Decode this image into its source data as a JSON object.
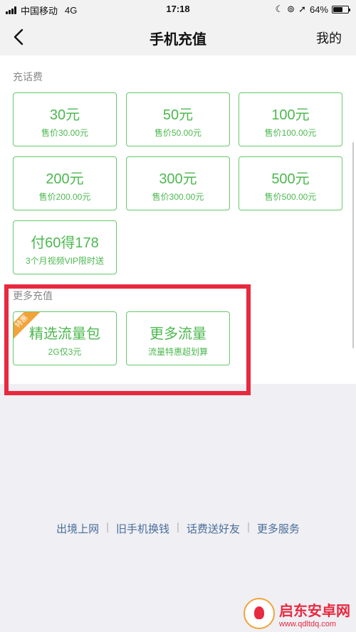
{
  "status_bar": {
    "carrier": "中国移动",
    "network": "4G",
    "time": "17:18",
    "battery": "64%",
    "battery_level": 0.64
  },
  "nav": {
    "title": "手机充值",
    "right_label": "我的"
  },
  "topup": {
    "section_label": "充话费",
    "cards": [
      {
        "amount": "30元",
        "price": "售价30.00元"
      },
      {
        "amount": "50元",
        "price": "售价50.00元"
      },
      {
        "amount": "100元",
        "price": "售价100.00元"
      },
      {
        "amount": "200元",
        "price": "售价200.00元"
      },
      {
        "amount": "300元",
        "price": "售价300.00元"
      },
      {
        "amount": "500元",
        "price": "售价500.00元"
      },
      {
        "amount": "付60得178",
        "price": "3个月视频VIP限时送"
      }
    ]
  },
  "more": {
    "section_label": "更多充值",
    "cards": [
      {
        "title": "精选流量包",
        "desc": "2G仅3元",
        "badge": "特惠"
      },
      {
        "title": "更多流量",
        "desc": "流量特惠超划算"
      }
    ]
  },
  "footer_links": [
    "出境上网",
    "旧手机换钱",
    "话费送好友",
    "更多服务"
  ],
  "watermark": {
    "title": "启东安卓网",
    "url": "www.qdltdq.com"
  },
  "colors": {
    "accent_green": "#4cb84f",
    "card_border": "#67c86b",
    "highlight_red": "#e8293f",
    "link_blue": "#4a6d99"
  }
}
